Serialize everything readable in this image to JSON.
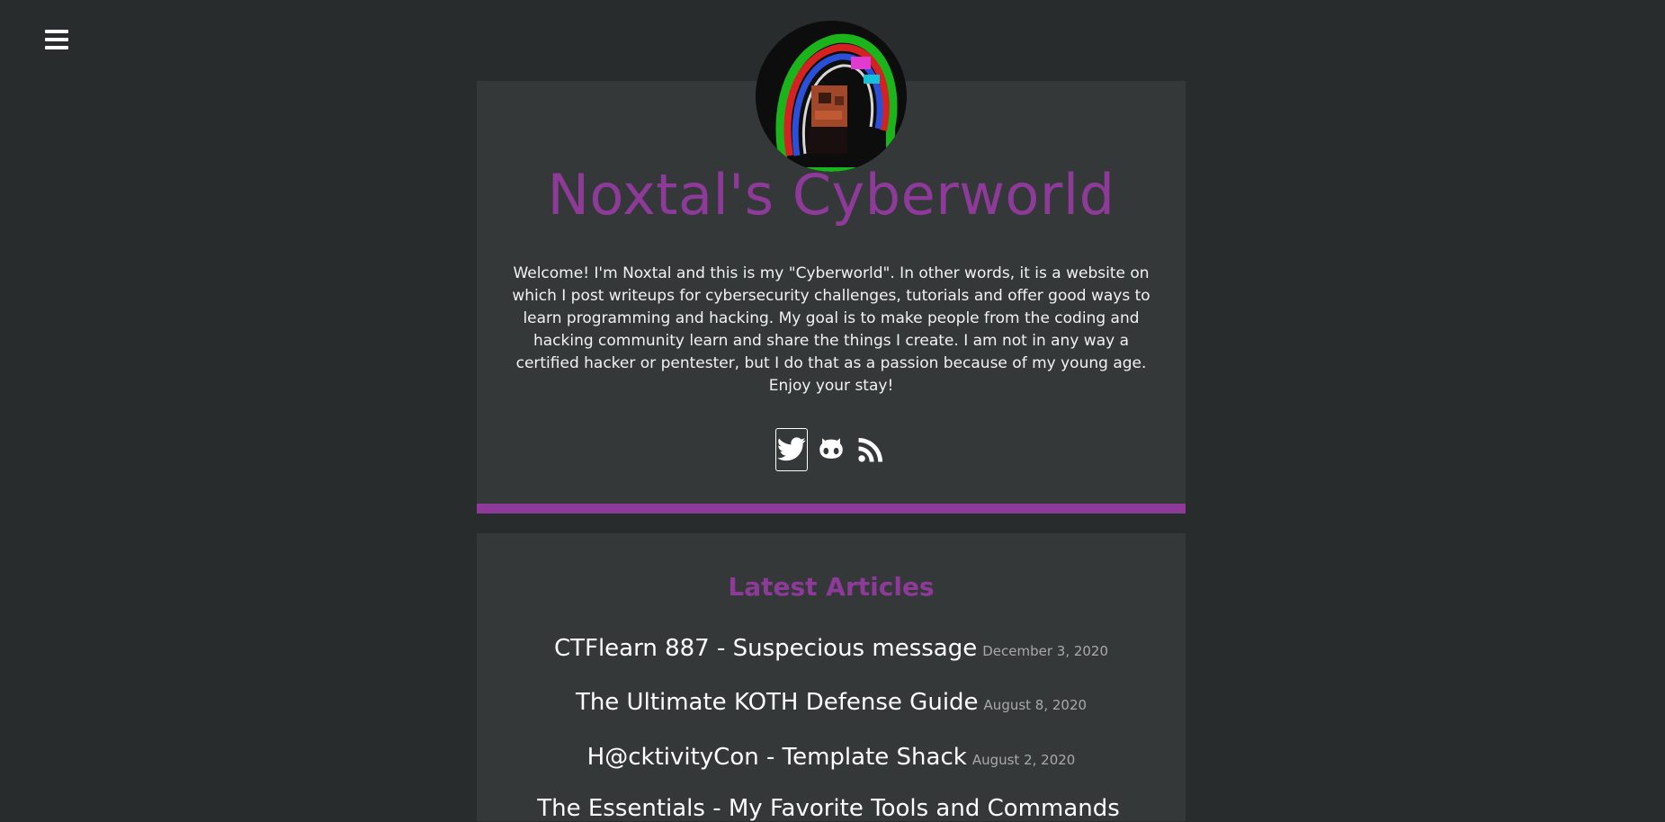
{
  "nav": {
    "menu_icon": "hamburger-menu-icon"
  },
  "header": {
    "avatar_alt": "avatar",
    "title": "Noxtal's Cyberworld",
    "intro": "Welcome! I'm Noxtal and this is my \"Cyberworld\". In other words, it is a website on which I post writeups for cybersecurity challenges, tutorials and offer good ways to learn programming and hacking. My goal is to make people from the coding and hacking community learn and share the things I create. I am not in any way a certified hacker or pentester, but I do that as a passion because of my young age. Enjoy your stay!",
    "social": [
      {
        "icon": "twitter-icon"
      },
      {
        "icon": "github-icon"
      },
      {
        "icon": "rss-icon"
      }
    ],
    "accent_color": "#8e3a99"
  },
  "articles": {
    "heading": "Latest Articles",
    "items": [
      {
        "title": "CTFlearn 887 - Suspecious message",
        "date": "December 3, 2020"
      },
      {
        "title": "The Ultimate KOTH Defense Guide",
        "date": "August 8, 2020"
      },
      {
        "title": "H@cktivityCon - Template Shack",
        "date": "August 2, 2020"
      },
      {
        "title": "The Essentials - My Favorite Tools and Commands",
        "date": ""
      }
    ]
  }
}
